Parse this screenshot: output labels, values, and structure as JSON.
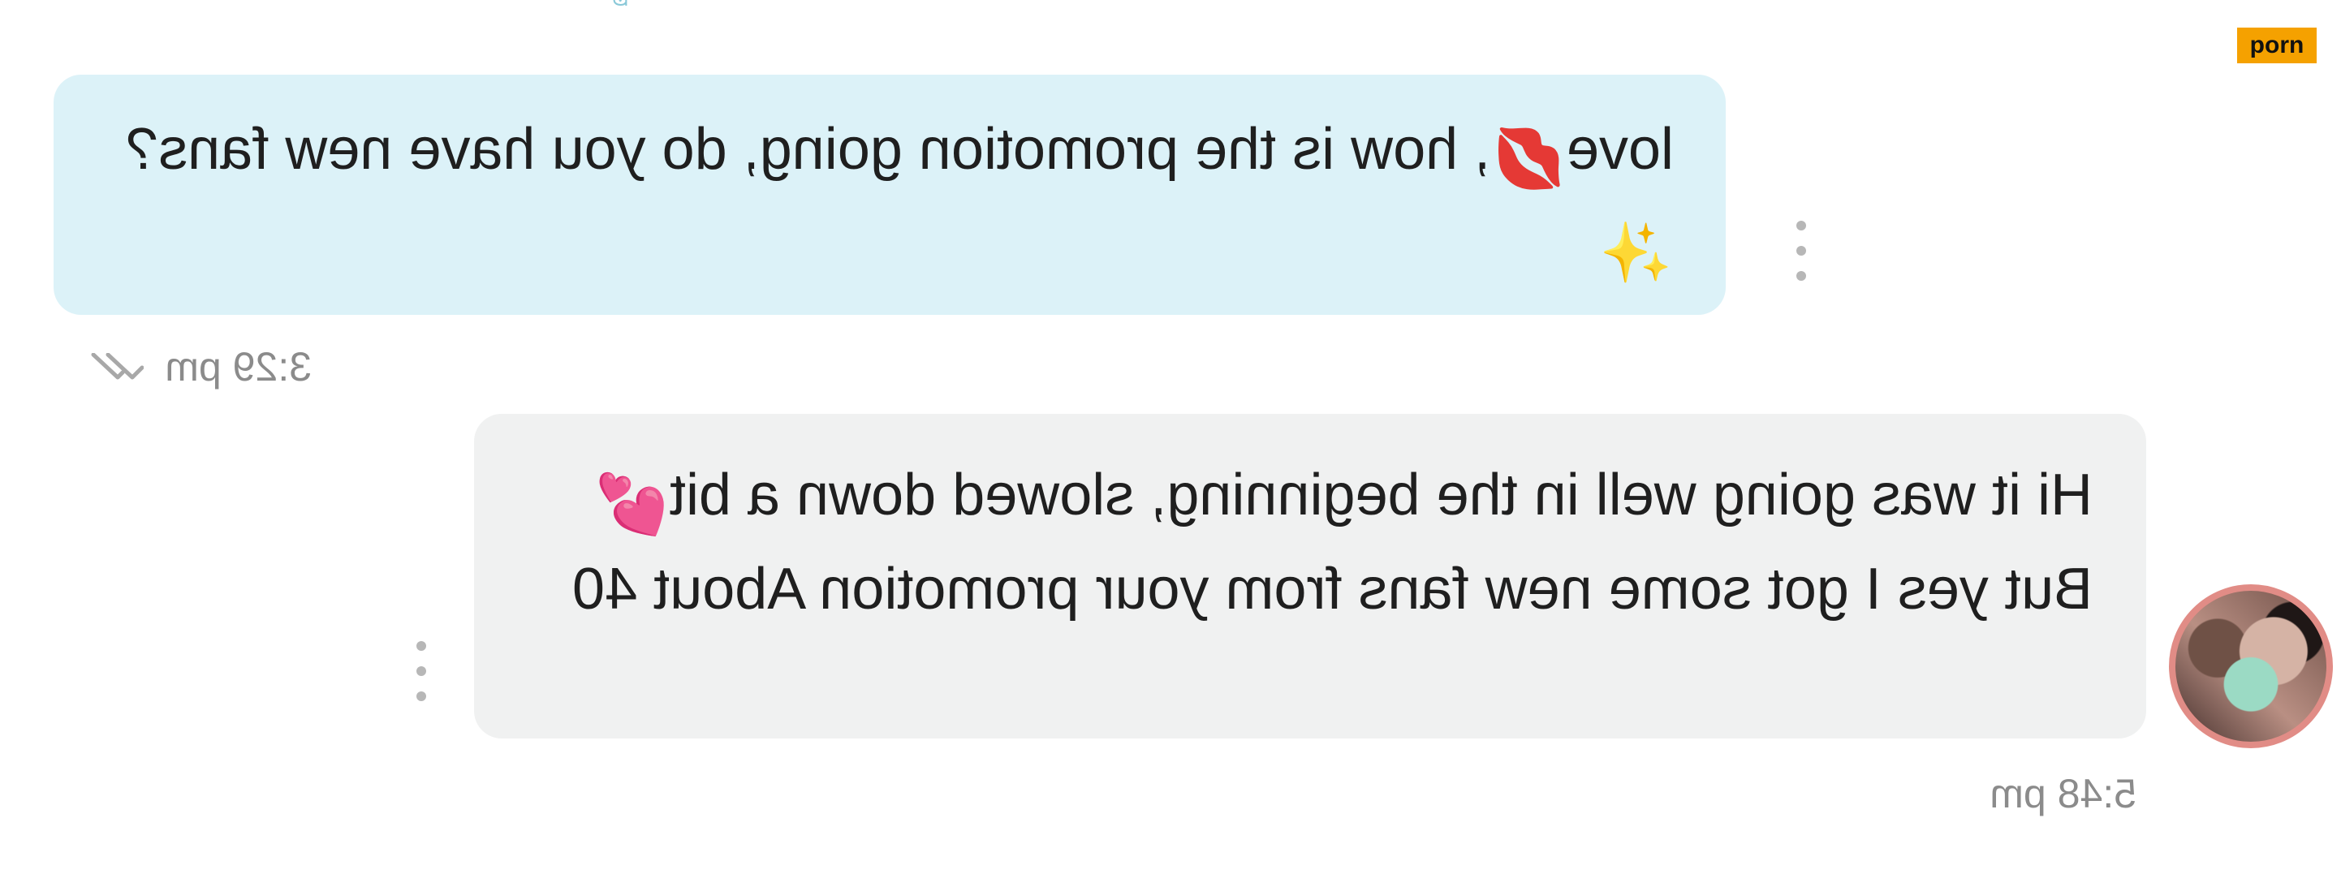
{
  "top_indicator": "ꕷ",
  "messages": [
    {
      "text_before": "love",
      "emoji_1": "💋",
      "text_after": ", how is the promotion going, do you have new fans?",
      "emoji_2": "✨",
      "time": "3:29 pm"
    },
    {
      "text_before": "Hi it was going well in the beginning, slowed down a bit",
      "emoji_1": "💕",
      "text_after": " But yes I got some new fans from your promotion About 40",
      "time": "5:48 pm"
    }
  ],
  "label": "porn",
  "icons": {
    "more": "more-options-icon",
    "read": "double-check-icon",
    "avatar": "profile-avatar"
  },
  "colors": {
    "incoming_bubble": "#dcf2f8",
    "outgoing_bubble": "#f0f1f1",
    "avatar_ring": "#e18c86",
    "label_bg": "#f5a100"
  }
}
